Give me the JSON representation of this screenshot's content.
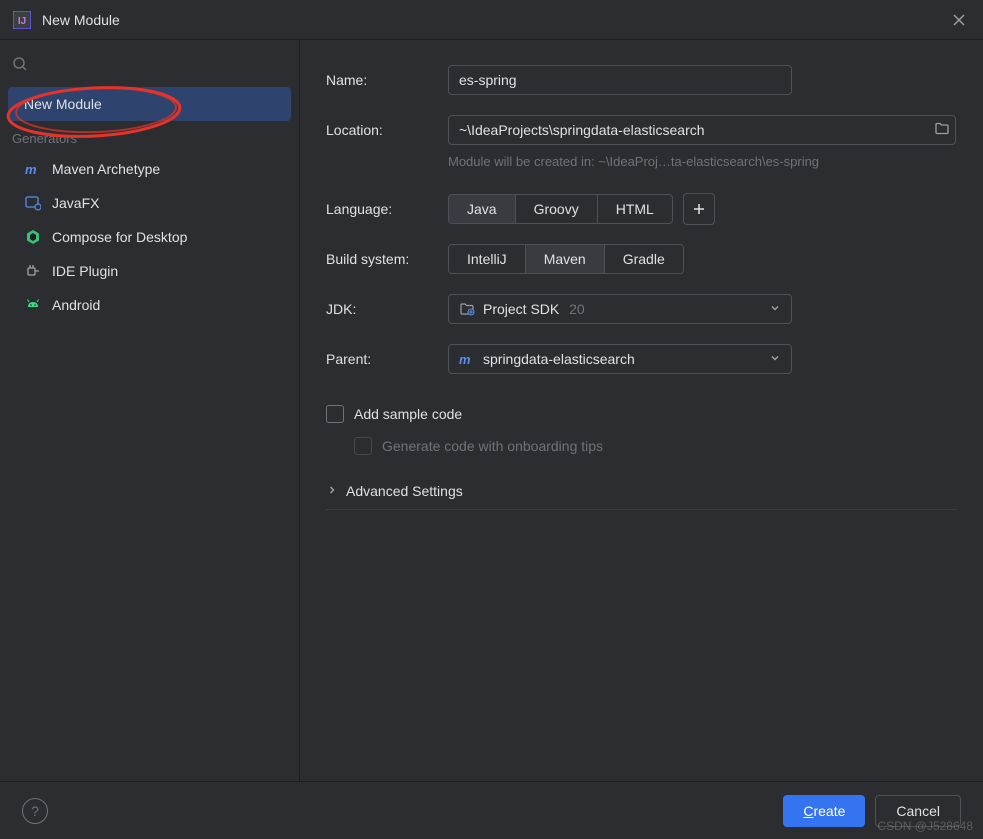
{
  "title": "New Module",
  "sidebar": {
    "selected_item": "New Module",
    "section_label": "Generators",
    "items": [
      {
        "label": "Maven Archetype",
        "icon": "maven"
      },
      {
        "label": "JavaFX",
        "icon": "javafx"
      },
      {
        "label": "Compose for Desktop",
        "icon": "compose"
      },
      {
        "label": "IDE Plugin",
        "icon": "plugin"
      },
      {
        "label": "Android",
        "icon": "android"
      }
    ]
  },
  "form": {
    "name_label": "Name:",
    "name_value": "es-spring",
    "location_label": "Location:",
    "location_value": "~\\IdeaProjects\\springdata-elasticsearch",
    "location_hint": "Module will be created in: ~\\IdeaProj…ta-elasticsearch\\es-spring",
    "language_label": "Language:",
    "language_options": [
      "Java",
      "Groovy",
      "HTML"
    ],
    "language_selected": "Java",
    "build_label": "Build system:",
    "build_options": [
      "IntelliJ",
      "Maven",
      "Gradle"
    ],
    "build_selected": "Maven",
    "jdk_label": "JDK:",
    "jdk_value": "Project SDK",
    "jdk_version": "20",
    "parent_label": "Parent:",
    "parent_value": "springdata-elasticsearch",
    "sample_code_label": "Add sample code",
    "onboarding_label": "Generate code with onboarding tips",
    "advanced_label": "Advanced Settings"
  },
  "footer": {
    "create_label": "Create",
    "cancel_label": "Cancel"
  },
  "watermark": "CSDN @J528648"
}
